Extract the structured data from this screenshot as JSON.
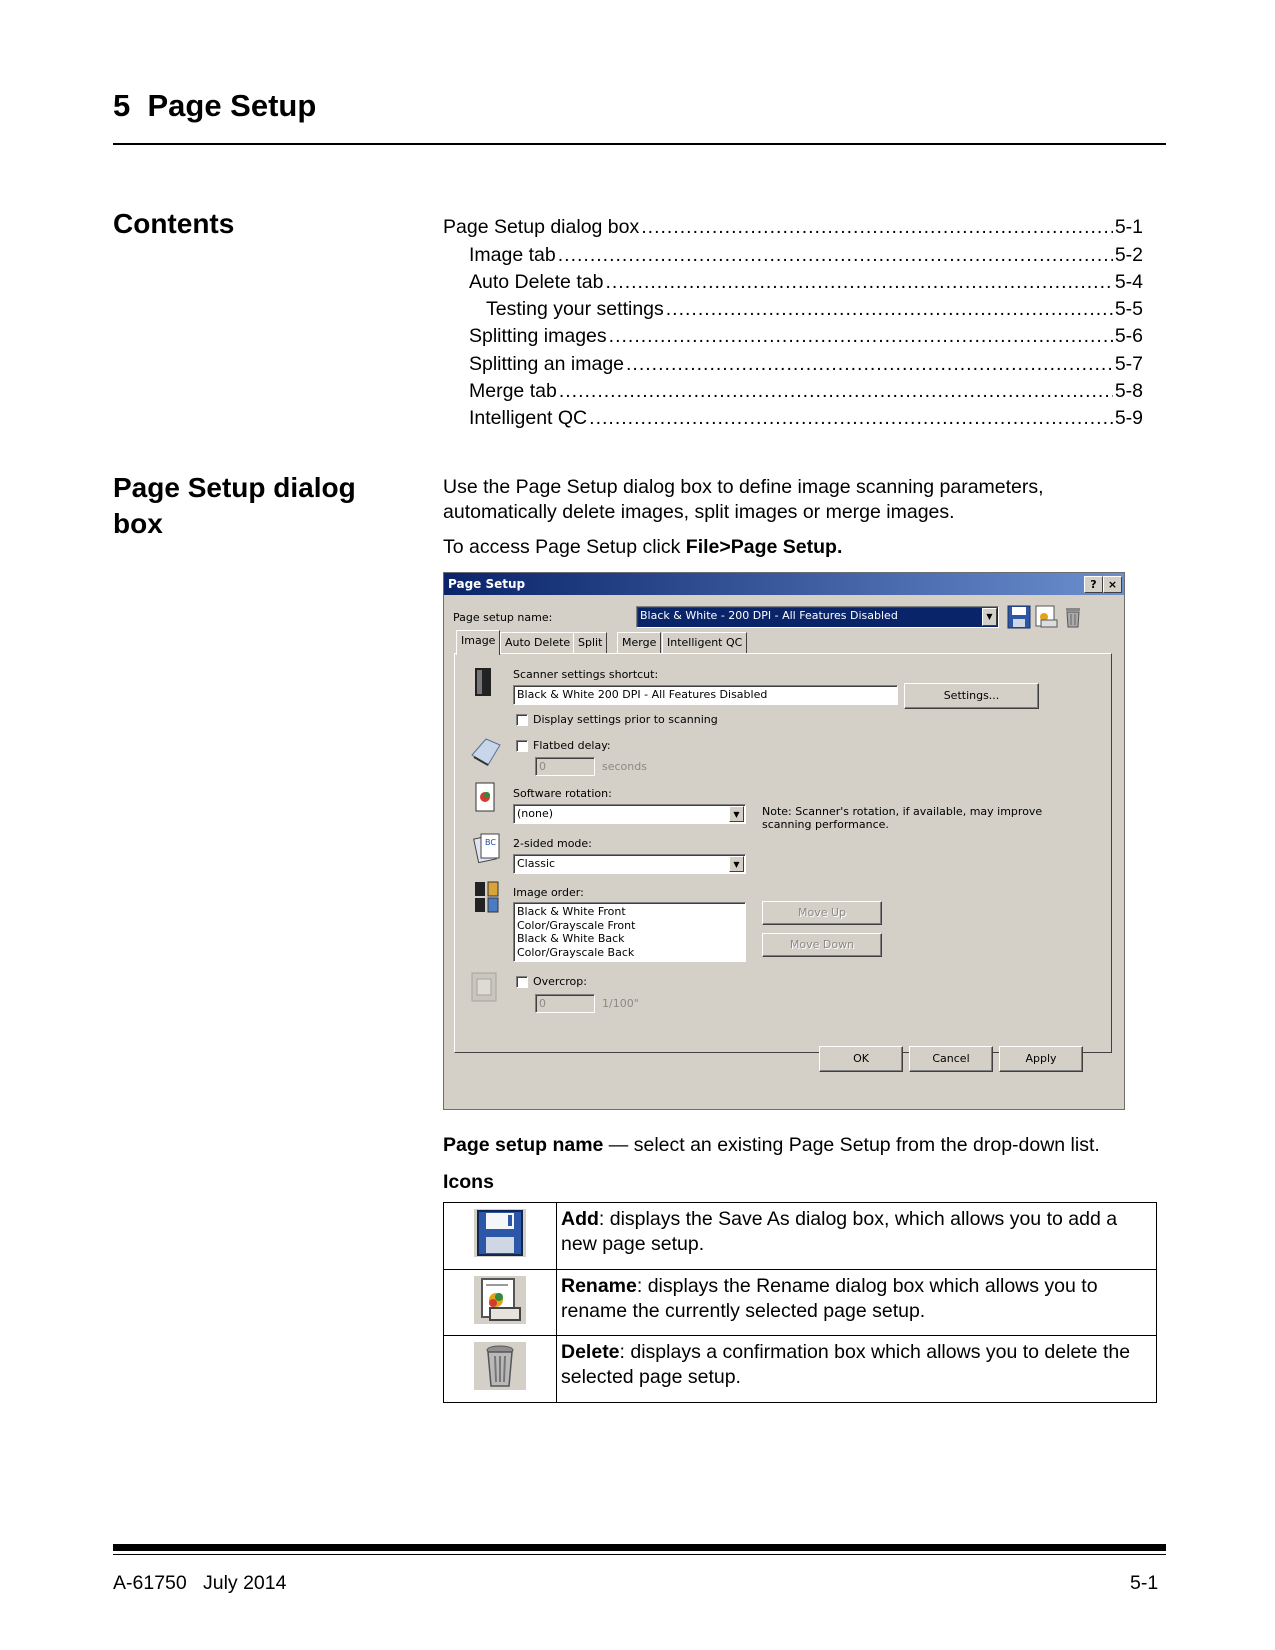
{
  "chapter": {
    "title": "5  Page Setup"
  },
  "contents": {
    "heading": "Contents",
    "entries": [
      {
        "text": "Page Setup dialog box",
        "page": "5-1"
      },
      {
        "text": "Image tab",
        "page": "5-2"
      },
      {
        "text": "Auto Delete tab",
        "page": "5-4"
      },
      {
        "text": "Testing your settings",
        "page": "5-5"
      },
      {
        "text": "Splitting images",
        "page": "5-6"
      },
      {
        "text": "Splitting an image",
        "page": "5-7"
      },
      {
        "text": "Merge tab",
        "page": "5-8"
      },
      {
        "text": "Intelligent QC",
        "page": "5-9"
      }
    ]
  },
  "section": {
    "heading": "Page Setup dialog box",
    "intro": "Use the Page Setup dialog box to define image scanning parameters, automatically delete images, split images or merge images.",
    "access_prefix": "To access Page Setup click ",
    "access_bold": "File>Page Setup.",
    "name_bold": "Page setup name",
    "name_rest": " — select an existing Page Setup from the drop-down list."
  },
  "dialog": {
    "title": "Page Setup",
    "help_btn": "?",
    "close_btn": "×",
    "name_label": "Page setup name:",
    "name_value": "Black & White - 200 DPI - All Features Disabled",
    "tabs": [
      "Image",
      "Auto Delete",
      "Split",
      "Merge",
      "Intelligent QC"
    ],
    "scanner_label": "Scanner settings shortcut:",
    "scanner_value": "Black & White 200 DPI - All Features Disabled",
    "settings_btn": "Settings...",
    "display_settings": "Display settings prior to scanning",
    "flatbed_label": "Flatbed delay:",
    "flatbed_value": "0",
    "flatbed_unit": "seconds",
    "rotation_label": "Software rotation:",
    "rotation_value": "(none)",
    "rotation_note": "Note: Scanner's rotation, if available, may improve scanning performance.",
    "twosided_label": "2-sided mode:",
    "twosided_value": "Classic",
    "order_label": "Image order:",
    "order_items": [
      "Black & White Front",
      "Color/Grayscale Front",
      "Black & White Back",
      "Color/Grayscale Back"
    ],
    "move_up": "Move Up",
    "move_down": "Move Down",
    "overcrop_label": "Overcrop:",
    "overcrop_value": "0",
    "overcrop_unit": "1/100\"",
    "ok": "OK",
    "cancel": "Cancel",
    "apply": "Apply"
  },
  "icons": {
    "heading": "Icons",
    "rows": [
      {
        "icon": "save-icon",
        "bold": "Add",
        "text": ": displays the Save As dialog box, which allows you to add a new page setup."
      },
      {
        "icon": "rename-icon",
        "bold": "Rename",
        "text": ": displays the Rename dialog box which allows you to rename the currently selected page setup."
      },
      {
        "icon": "trash-icon",
        "bold": "Delete",
        "text": ": displays a confirmation box which allows you to delete the selected page setup."
      }
    ]
  },
  "footer": {
    "left": "A-61750   July 2014",
    "right": "5-1"
  }
}
